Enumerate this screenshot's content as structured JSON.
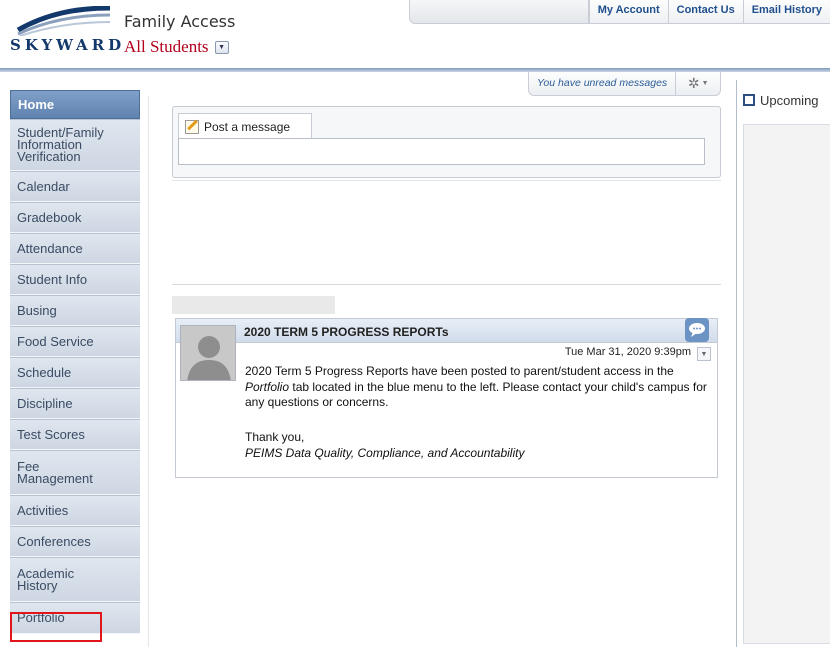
{
  "header": {
    "logo_text": "SKYWARD",
    "app_title": "Family Access",
    "student_selector": "All Students",
    "top_links": [
      "My Account",
      "Contact Us",
      "Email History"
    ]
  },
  "toolbar": {
    "unread_messages": "You have unread messages"
  },
  "sidebar": {
    "items": [
      {
        "label": "Home",
        "active": true
      },
      {
        "label": "Student/Family Information Verification"
      },
      {
        "label": "Calendar"
      },
      {
        "label": "Gradebook"
      },
      {
        "label": "Attendance"
      },
      {
        "label": "Student Info"
      },
      {
        "label": "Busing"
      },
      {
        "label": "Food Service"
      },
      {
        "label": "Schedule"
      },
      {
        "label": "Discipline"
      },
      {
        "label": "Test Scores"
      },
      {
        "label": "Fee Management"
      },
      {
        "label": "Activities"
      },
      {
        "label": "Conferences"
      },
      {
        "label": "Academic History"
      },
      {
        "label": "Portfolio",
        "highlighted": true
      }
    ]
  },
  "post": {
    "tab_label": "Post a message",
    "input_value": ""
  },
  "message": {
    "title": "2020 TERM 5 PROGRESS REPORTs",
    "date": "Tue Mar 31, 2020 9:39pm",
    "body_part1": "2020 Term 5 Progress Reports have been posted to parent/student access in the ",
    "body_italic": "Portfolio",
    "body_part2": " tab located in the blue menu to the left. Please contact your child's campus for any questions or concerns.",
    "thank_you": "Thank you,",
    "signature": "PEIMS Data Quality, Compliance, and Accountability"
  },
  "right_panel": {
    "title": "Upcoming"
  },
  "colors": {
    "brand_blue": "#13386b",
    "student_red": "#b3001b",
    "nav_active": "#6b8dba",
    "highlight_red": "#e0161b"
  }
}
